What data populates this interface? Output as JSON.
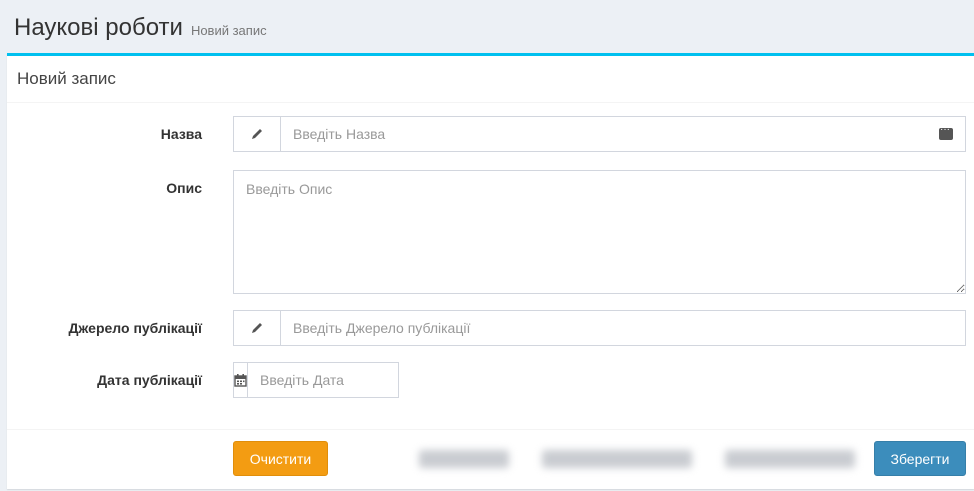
{
  "header": {
    "title": "Наукові роботи",
    "subtitle": "Новий запис"
  },
  "box": {
    "title": "Новий запис"
  },
  "form": {
    "name": {
      "label": "Назва",
      "placeholder": "Введіть Назва",
      "icon": "pencil-icon"
    },
    "description": {
      "label": "Опис",
      "placeholder": "Введіть Опис"
    },
    "source": {
      "label": "Джерело публікації",
      "placeholder": "Введіть Джерело публікації",
      "icon": "pencil-icon"
    },
    "date": {
      "label": "Дата публікації",
      "placeholder": "Введіть Дата",
      "icon": "calendar-icon"
    }
  },
  "footer": {
    "clear_label": "Очистити",
    "save_label": "Зберегти"
  },
  "colors": {
    "accent": "#00c0ef",
    "warning": "#f39c12",
    "primary": "#3c8dbc"
  }
}
